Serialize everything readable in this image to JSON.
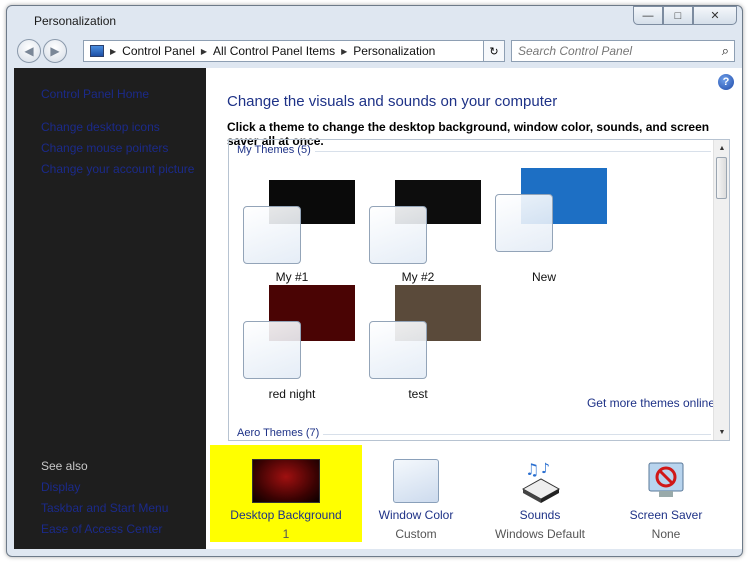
{
  "window": {
    "title": "Personalization",
    "controls": {
      "minimize": "—",
      "maximize": "□",
      "close": "✕"
    }
  },
  "nav": {
    "back_icon": "◀",
    "forward_icon": "▶",
    "breadcrumb": [
      "Control Panel",
      "All Control Panel Items",
      "Personalization"
    ],
    "breadcrumb_sep": "▶",
    "dropdown_icon": "▼",
    "refresh_icon": "↻",
    "search_placeholder": "Search Control Panel",
    "search_icon": "⌕"
  },
  "sidebar": {
    "links": [
      "Control Panel Home",
      "Change desktop icons",
      "Change mouse pointers",
      "Change your account picture"
    ],
    "see_also_label": "See also",
    "see_also_links": [
      "Display",
      "Taskbar and Start Menu",
      "Ease of Access Center"
    ]
  },
  "main": {
    "help_icon": "?",
    "heading": "Change the visuals and sounds on your computer",
    "subheading": "Click a theme to change the desktop background, window color, sounds, and screen saver all at once.",
    "groups": [
      {
        "label": "My Themes (5)"
      },
      {
        "label": "Aero Themes (7)"
      }
    ],
    "themes": [
      {
        "name": "My #1",
        "color": "#0a0a0a"
      },
      {
        "name": "My #2",
        "color": "#0d0d0d"
      },
      {
        "name": "New",
        "color": "#1d6fc4"
      },
      {
        "name": "red night",
        "color": "#4a0404"
      },
      {
        "name": "test",
        "color": "#5a4a3a"
      }
    ],
    "get_more": "Get more themes online",
    "scroll": {
      "up": "▲",
      "down": "▼"
    }
  },
  "bottom": [
    {
      "title": "Desktop Background",
      "value": "1",
      "selected": true
    },
    {
      "title": "Window Color",
      "value": "Custom",
      "selected": false
    },
    {
      "title": "Sounds",
      "value": "Windows Default",
      "selected": false
    },
    {
      "title": "Screen Saver",
      "value": "None",
      "selected": false
    }
  ]
}
